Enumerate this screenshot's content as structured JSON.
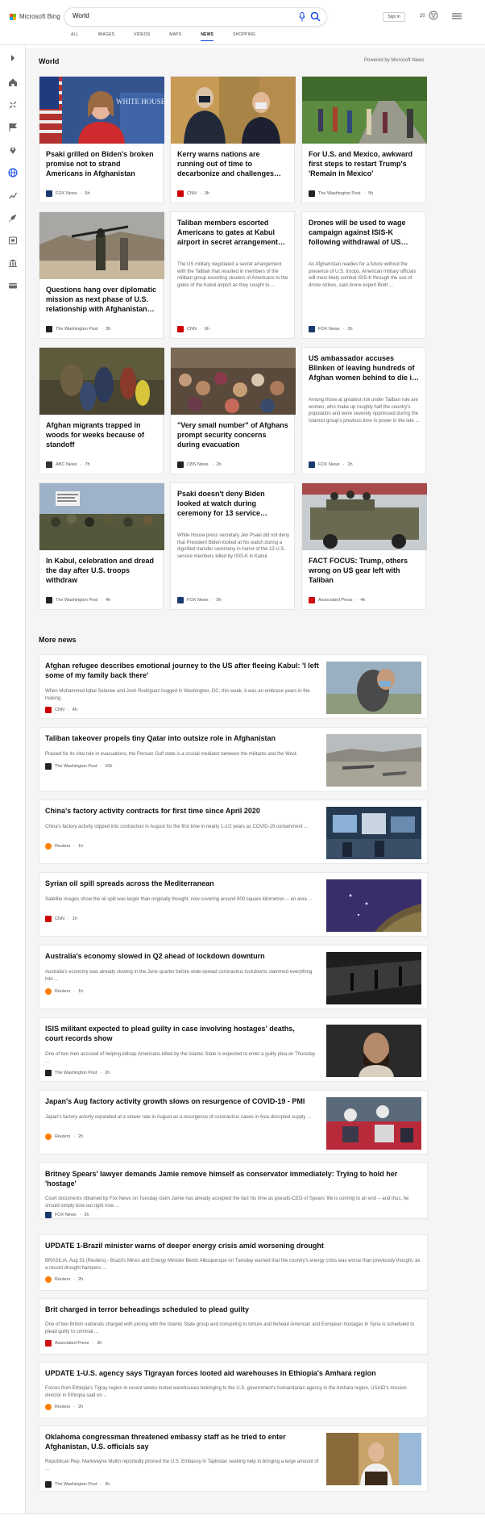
{
  "header": {
    "brand": "Microsoft Bing",
    "search_value": "World",
    "signin_label": "Sign in",
    "reward_count": "20"
  },
  "tabs": [
    {
      "label": "ALL"
    },
    {
      "label": "IMAGES"
    },
    {
      "label": "VIDEOS"
    },
    {
      "label": "MAPS"
    },
    {
      "label": "NEWS",
      "active": true
    },
    {
      "label": "SHOPPING"
    }
  ],
  "world": {
    "title": "World",
    "powered_by": "Powered by Microsoft News"
  },
  "cards": [
    {
      "title": "Psaki grilled on Biden's broken promise not to strand Americans in Afghanistan",
      "snippet": "",
      "source": "FOX News",
      "age": "5h",
      "src_color": "#1a3a6e"
    },
    {
      "title": "Kerry warns nations are running out of time to decarbonize and challenges…",
      "snippet": "",
      "source": "CNN",
      "age": "3h",
      "src_color": "#cc0000"
    },
    {
      "title": "For U.S. and Mexico, awkward first steps to restart Trump's 'Remain in Mexico'",
      "snippet": "",
      "source": "The Washington Post",
      "age": "5h",
      "src_color": "#222222"
    },
    {
      "title": "Questions hang over diplomatic mission as next phase of U.S. relationship with Afghanistan…",
      "snippet": "",
      "source": "The Washington Post",
      "age": "3h",
      "src_color": "#222222"
    },
    {
      "title": "Taliban members escorted Americans to gates at Kabul airport in secret arrangement…",
      "snippet": "The US military negotiated a secret arrangement with the Taliban that resulted in members of the militant group escorting clusters of Americans to the gates of the Kabul airport as they sought to ...",
      "source": "CNN",
      "age": "6h",
      "src_color": "#cc0000"
    },
    {
      "title": "Drones will be used to wage campaign against ISIS-K following withdrawal of US…",
      "snippet": "As Afghanistan readies for a future without the presence of U.S. troops, American military officials will most likely combat ISIS-K through the use of drone strikes, said drone expert Brett ...",
      "source": "FOX News",
      "age": "2h",
      "src_color": "#1a3a6e"
    },
    {
      "title": "Afghan migrants trapped in woods for weeks because of standoff",
      "snippet": "",
      "source": "ABC News",
      "age": "7h",
      "src_color": "#333333"
    },
    {
      "title": "\"Very small number\" of Afghans prompt security concerns during evacuation",
      "snippet": "",
      "source": "CBS News",
      "age": "2h",
      "src_color": "#222222"
    },
    {
      "title": "US ambassador accuses Blinken of leaving hundreds of Afghan women behind to die i…",
      "snippet": "Among those at greatest risk under Taliban rule are women, who make up roughly half the country's population and were severely oppressed during the Islamist group's previous time in power in the late ...",
      "source": "FOX News",
      "age": "2h",
      "src_color": "#1a3a6e"
    },
    {
      "title": "In Kabul, celebration and dread the day after U.S. troops withdraw",
      "snippet": "",
      "source": "The Washington Post",
      "age": "4h",
      "src_color": "#222222"
    },
    {
      "title": "Psaki doesn't deny Biden looked at watch during ceremony for 13 service…",
      "snippet": "White House press secretary Jen Psaki did not deny that President Biden looked at his watch during a dignified transfer ceremony in honor of the 13 U.S. service members killed by ISIS-K in Kabul.",
      "source": "FOX News",
      "age": "5h",
      "src_color": "#1a3a6e"
    },
    {
      "title": "FACT FOCUS: Trump, others wrong on US gear left with Taliban",
      "snippet": "",
      "source": "Associated Press",
      "age": "4h",
      "src_color": "#cc1111"
    }
  ],
  "more_news": {
    "title": "More news",
    "items": [
      {
        "title": "Afghan refugee describes emotional journey to the US after fleeing Kabul: 'I left some of my family back there'",
        "snippet": "When Mohammed Iqbal Selanee and Josh Rodriguez hugged in Washington, DC, this week, it was an embrace years in the making.",
        "source": "CNN",
        "age": "4h",
        "src_color": "#cc0000",
        "thumb": true
      },
      {
        "title": "Taliban takeover propels tiny Qatar into outsize role in Afghanistan",
        "snippet": "Praised for its vital role in evacuations, the Persian Gulf state is a crucial mediator between the militants and the West.",
        "source": "The Washington Post",
        "age": "10h",
        "src_color": "#222222",
        "thumb": true
      },
      {
        "title": "China's factory activity contracts for first time since April 2020",
        "snippet": "China's factory activity slipped into contraction in August for the first time in nearly 1-1/2 years as COVID-19 containment ...",
        "source": "Reuters",
        "age": "1h",
        "src_color": "#ff8000",
        "thumb": true
      },
      {
        "title": "Syrian oil spill spreads across the Mediterranean",
        "snippet": "Satellite images show the oil spill was larger than originally thought, now covering around 800 square kilometres -- an area ...",
        "source": "CNN",
        "age": "1h",
        "src_color": "#cc0000",
        "thumb": true
      },
      {
        "title": "Australia's economy slowed in Q2 ahead of lockdown downturn",
        "snippet": "Australia's economy was already slowing in the June quarter before wide-spread coronavirus lockdowns slammed everything into ...",
        "source": "Reuters",
        "age": "1h",
        "src_color": "#ff8000",
        "thumb": true
      },
      {
        "title": "ISIS militant expected to plead guilty in case involving hostages' deaths, court records show",
        "snippet": "One of two men accused of helping kidnap Americans killed by the Islamic State is expected to enter a guilty plea on Thursday ...",
        "source": "The Washington Post",
        "age": "2h",
        "src_color": "#222222",
        "thumb": true
      },
      {
        "title": "Japan's Aug factory activity growth slows on resurgence of COVID-19 - PMI",
        "snippet": "Japan's factory activity expanded at a slower rate in August as a resurgence of coronavirus cases in Asia disrupted supply ...",
        "source": "Reuters",
        "age": "2h",
        "src_color": "#ff8000",
        "thumb": true
      },
      {
        "title": "Britney Spears' lawyer demands Jamie remove himself as conservator immediately: Trying to hold her 'hostage'",
        "snippet": "Court documents obtained by Fox News on Tuesday claim Jamie has already accepted the fact his time as pseudo-CEO of Spears' life is coming to an end -- and thus, he should simply bow out right now ...",
        "source": "FOX News",
        "age": "2h",
        "src_color": "#1a3a6e",
        "thumb": false
      },
      {
        "title": "UPDATE 1-Brazil minister warns of deeper energy crisis amid worsening drought",
        "snippet": "BRASILIA, Aug 31 (Reuters) - Brazil's Mines and Energy Minister Bento Albuquerque on Tuesday warned that the country's energy crisis was worse than previously thought, as a record drought hampers ...",
        "source": "Reuters",
        "age": "2h",
        "src_color": "#ff8000",
        "thumb": false
      },
      {
        "title": "Brit charged in terror beheadings scheduled to plead guilty",
        "snippet": "One of two British nationals charged with joining with the Islamic State group and conspiring to torture and behead American and European hostages in Syria is scheduled to plead guilty to criminal ...",
        "source": "Associated Press",
        "age": "3h",
        "src_color": "#cc1111",
        "thumb": false
      },
      {
        "title": "UPDATE 1-U.S. agency says Tigrayan forces looted aid warehouses in Ethiopia's Amhara region",
        "snippet": "Forces from Ethiopia's Tigray region in recent weeks looted warehouses belonging to the U.S. government's humanitarian agency in the Amhara region, USAID's mission director in Ethiopia said on ...",
        "source": "Reuters",
        "age": "2h",
        "src_color": "#ff8000",
        "thumb": false
      },
      {
        "title": "Oklahoma congressman threatened embassy staff as he tried to enter Afghanistan, U.S. officials say",
        "snippet": "Republican Rep. Markwayne Mullin reportedly phoned the U.S. Embassy in Tajikistan seeking help in bringing a large amount of ...",
        "source": "The Washington Post",
        "age": "3h",
        "src_color": "#222222",
        "thumb": true
      }
    ]
  }
}
